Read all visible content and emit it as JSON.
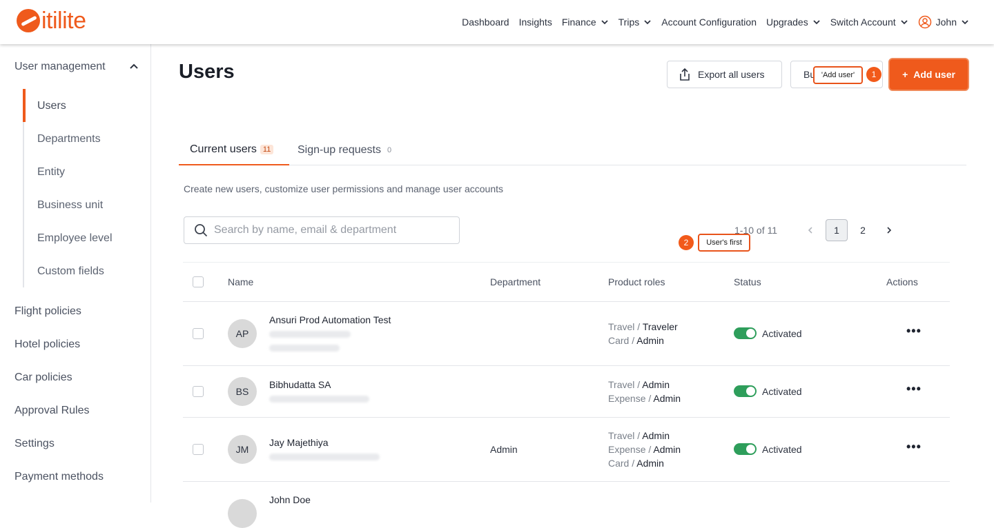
{
  "brand": {
    "name": "itilite",
    "accent": "#ef5a1c"
  },
  "nav": {
    "dashboard": "Dashboard",
    "insights": "Insights",
    "finance": "Finance",
    "trips": "Trips",
    "account_configuration": "Account Configuration",
    "upgrades": "Upgrades",
    "switch_account": "Switch Account",
    "user": "John"
  },
  "sidebar": {
    "group": "User management",
    "subitems": [
      "Users",
      "Departments",
      "Entity",
      "Business unit",
      "Employee level",
      "Custom fields"
    ],
    "items": [
      "Flight policies",
      "Hotel policies",
      "Car policies",
      "Approval Rules",
      "Settings",
      "Payment methods"
    ]
  },
  "page": {
    "title": "Users",
    "export_label": "Export all users",
    "bulk_label": "Bu",
    "add_label": "Add user",
    "callout1": "'Add user'",
    "callout1_num": "1",
    "callout2": "User's first",
    "callout2_num": "2"
  },
  "tabs": {
    "current": {
      "label": "Current users",
      "count": "11"
    },
    "signup": {
      "label": "Sign-up requests",
      "count": "0"
    }
  },
  "description": "Create new users, customize user permissions and manage user accounts",
  "search": {
    "placeholder": "Search by name, email & department"
  },
  "pager": {
    "range": "1-10 of 11",
    "pages": [
      "1",
      "2"
    ]
  },
  "table": {
    "headers": {
      "name": "Name",
      "department": "Department",
      "roles": "Product roles",
      "status": "Status",
      "actions": "Actions"
    },
    "rows": [
      {
        "initials": "AP",
        "name": "Ansuri Prod Automation Test",
        "department": "",
        "roles": [
          {
            "product": "Travel",
            "role": "Traveler"
          },
          {
            "product": "Card",
            "role": "Admin"
          }
        ],
        "status": "Activated"
      },
      {
        "initials": "BS",
        "name": "Bibhudatta SA",
        "department": "",
        "roles": [
          {
            "product": "Travel",
            "role": "Admin"
          },
          {
            "product": "Expense",
            "role": "Admin"
          }
        ],
        "status": "Activated"
      },
      {
        "initials": "JM",
        "name": "Jay Majethiya",
        "department": "Admin",
        "roles": [
          {
            "product": "Travel",
            "role": "Admin"
          },
          {
            "product": "Expense",
            "role": "Admin"
          },
          {
            "product": "Card",
            "role": "Admin"
          }
        ],
        "status": "Activated"
      },
      {
        "initials": "",
        "name": "John Doe"
      }
    ]
  }
}
